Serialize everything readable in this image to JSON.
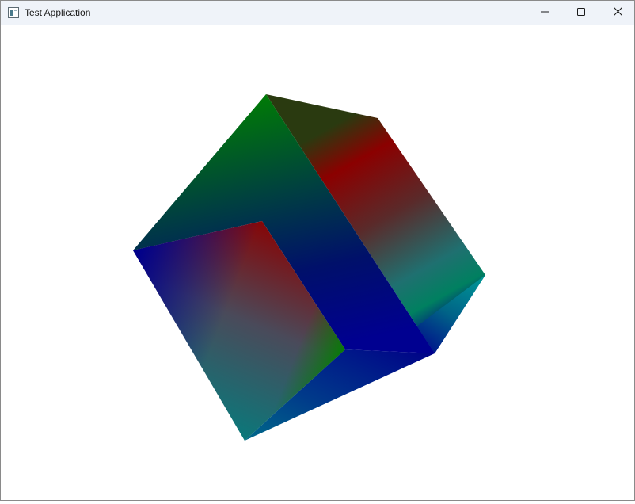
{
  "window": {
    "title": "Test Application",
    "icon": "app-window-icon",
    "controls": [
      {
        "name": "minimize-button",
        "icon": "minimize-icon"
      },
      {
        "name": "maximize-button",
        "icon": "maximize-icon"
      },
      {
        "name": "close-button",
        "icon": "close-icon"
      }
    ]
  },
  "scene": {
    "object": "cube",
    "colors": {
      "red": "#8b0000",
      "green": "#008000",
      "blue": "#00008b",
      "teal": "#008080"
    }
  }
}
